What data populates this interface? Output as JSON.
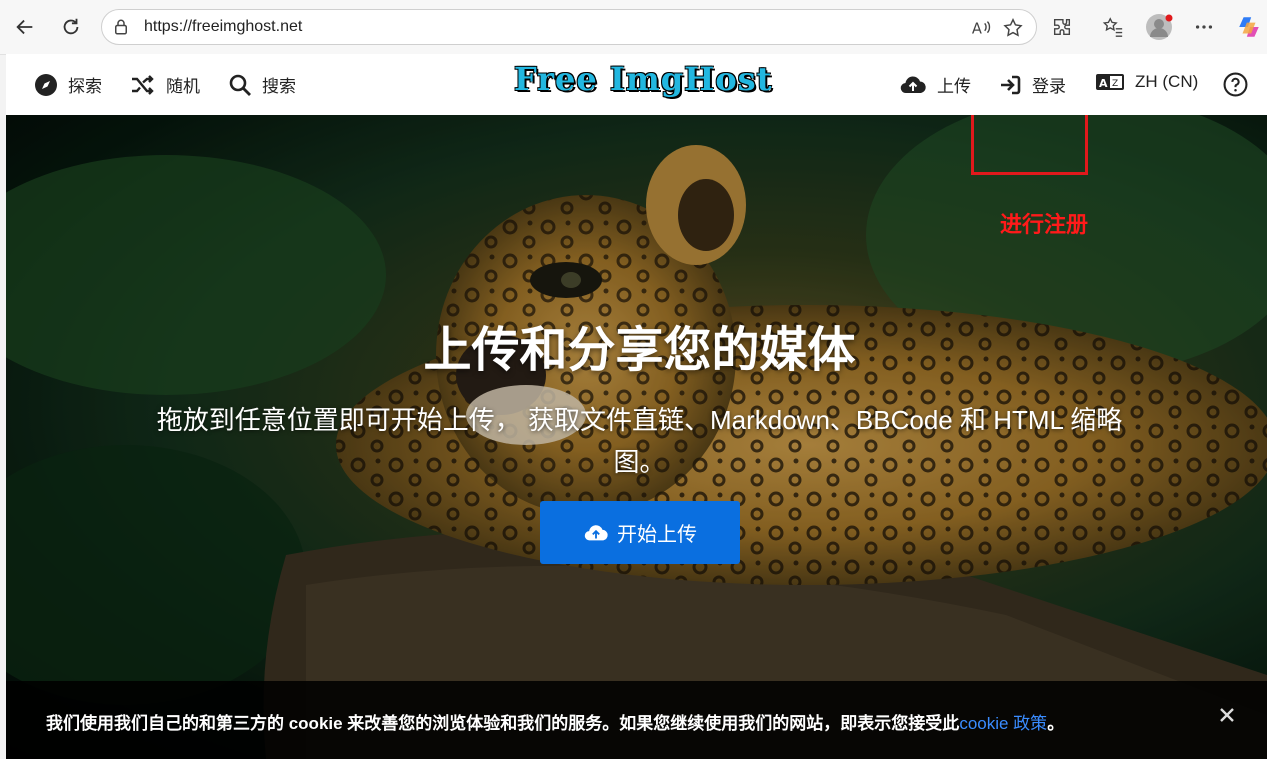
{
  "browser": {
    "url": "https://freeimghost.net"
  },
  "site": {
    "logo": "Free ImgHost",
    "nav_left": [
      {
        "label": "探索",
        "icon": "compass-icon"
      },
      {
        "label": "随机",
        "icon": "shuffle-icon"
      },
      {
        "label": "搜索",
        "icon": "search-icon"
      }
    ],
    "nav_right": {
      "upload": "上传",
      "login": "登录",
      "language": "ZH (CN)",
      "help_icon": "help-icon"
    }
  },
  "annotation": {
    "label": "进行注册",
    "color": "#e0191c"
  },
  "hero": {
    "title": "上传和分享您的媒体",
    "subtitle": "拖放到任意位置即可开始上传， 获取文件直链、Markdown、BBCode 和 HTML 缩略图。",
    "cta": "开始上传"
  },
  "cookie": {
    "text": "我们使用我们自己的和第三方的 cookie 来改善您的浏览体验和我们的服务。如果您继续使用我们的网站，即表示您接受此",
    "link": "cookie 政策",
    "end": "。"
  },
  "colors": {
    "primary": "#0a6fe0",
    "logo": "#22b7e0"
  }
}
